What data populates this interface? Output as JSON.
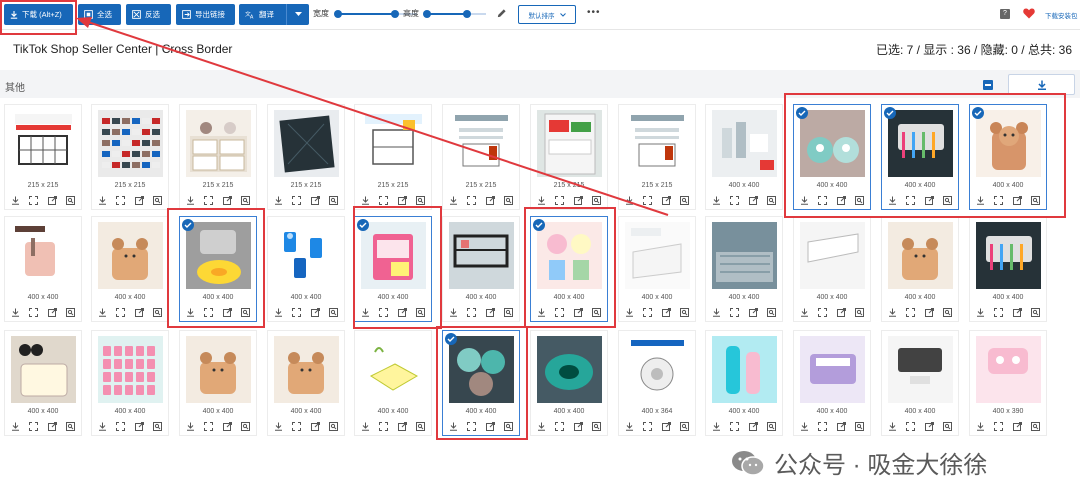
{
  "toolbar": {
    "download_label": "下载 (Alt+Z)",
    "select_all_label": "全选",
    "invert_label": "反选",
    "export_label": "导出链接",
    "translate_label": "翻译",
    "width_label": "宽度",
    "width_value": 0.72,
    "height_label": "高度",
    "height_value": 0.68,
    "sort_label": "默认排序",
    "more_label": "•••",
    "help_label": "?",
    "install_label": "下载安装包",
    "accent_color": "#1767b8",
    "highlight_color": "#e0393e"
  },
  "header": {
    "title": "TikTok Shop Seller Center | Cross Border",
    "stats": "已选: 7 / 显示 : 36 / 隐藏: 0 / 总共: 36"
  },
  "group": {
    "name": "其他"
  },
  "images": [
    {
      "dim": "215 x 215",
      "selected": false,
      "art": "banner"
    },
    {
      "dim": "215 x 215",
      "selected": false,
      "art": "shelf"
    },
    {
      "dim": "215 x 215",
      "selected": false,
      "art": "drawers"
    },
    {
      "dim": "215 x 215",
      "selected": false,
      "art": "dark"
    },
    {
      "dim": "215 x 215",
      "selected": false,
      "art": "rack"
    },
    {
      "dim": "215 x 215",
      "selected": false,
      "art": "doc"
    },
    {
      "dim": "215 x 215",
      "selected": false,
      "art": "fridge"
    },
    {
      "dim": "215 x 215",
      "selected": false,
      "art": "doc"
    },
    {
      "dim": "400 x 400",
      "selected": false,
      "art": "bath"
    },
    {
      "dim": "400 x 400",
      "selected": true,
      "art": "teal"
    },
    {
      "dim": "400 x 400",
      "selected": true,
      "art": "brush"
    },
    {
      "dim": "400 x 400",
      "selected": true,
      "art": "bear"
    },
    {
      "dim": "400 x 400",
      "selected": false,
      "art": "pinkcup"
    },
    {
      "dim": "400 x 400",
      "selected": false,
      "art": "bearcup"
    },
    {
      "dim": "400 x 400",
      "selected": true,
      "art": "drain"
    },
    {
      "dim": "400 x 400",
      "selected": false,
      "art": "plugs"
    },
    {
      "dim": "400 x 400",
      "selected": true,
      "art": "pinkbox"
    },
    {
      "dim": "400 x 400",
      "selected": false,
      "art": "blackrack"
    },
    {
      "dim": "400 x 400",
      "selected": true,
      "art": "cute"
    },
    {
      "dim": "400 x 400",
      "selected": false,
      "art": "white"
    },
    {
      "dim": "400 x 400",
      "selected": false,
      "art": "kitchen"
    },
    {
      "dim": "400 x 400",
      "selected": false,
      "art": "whiteshelf"
    },
    {
      "dim": "400 x 400",
      "selected": false,
      "art": "bearcup"
    },
    {
      "dim": "400 x 400",
      "selected": false,
      "art": "brush"
    },
    {
      "dim": "400 x 400",
      "selected": false,
      "art": "mickey"
    },
    {
      "dim": "400 x 400",
      "selected": false,
      "art": "grid"
    },
    {
      "dim": "400 x 400",
      "selected": false,
      "art": "bearcup"
    },
    {
      "dim": "400 x 400",
      "selected": false,
      "art": "bearcup"
    },
    {
      "dim": "400 x 400",
      "selected": false,
      "art": "sponge"
    },
    {
      "dim": "400 x 400",
      "selected": true,
      "art": "mats"
    },
    {
      "dim": "400 x 400",
      "selected": false,
      "art": "tealdrain"
    },
    {
      "dim": "400 x 364",
      "selected": false,
      "art": "filter"
    },
    {
      "dim": "400 x 400",
      "selected": false,
      "art": "travel"
    },
    {
      "dim": "400 x 400",
      "selected": false,
      "art": "lavender"
    },
    {
      "dim": "400 x 400",
      "selected": false,
      "art": "dispenser"
    },
    {
      "dim": "400 x 390",
      "selected": false,
      "art": "pinkdispenser"
    }
  ],
  "watermark": {
    "text": "公众号 · 吸金大徐徐"
  }
}
